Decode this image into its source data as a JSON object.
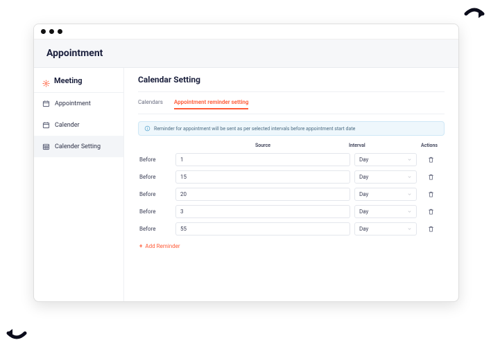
{
  "app_header": {
    "title": "Appointment"
  },
  "sidebar": {
    "top": {
      "label": "Meeting"
    },
    "items": [
      {
        "label": "Appointment"
      },
      {
        "label": "Calender"
      },
      {
        "label": "Calender Setting"
      }
    ]
  },
  "main": {
    "title": "Calendar Setting",
    "tabs": [
      {
        "label": "Calendars"
      },
      {
        "label": "Appointment reminder setting"
      }
    ],
    "info": "Reminder for appointment will be sent as per selected intervals before appointment start date",
    "columns": {
      "source": "Source",
      "interval": "Interval",
      "actions": "Actions"
    },
    "row_label": "Before",
    "interval_options": [
      "Day"
    ],
    "rows": [
      {
        "value": "1",
        "interval": "Day"
      },
      {
        "value": "15",
        "interval": "Day"
      },
      {
        "value": "20",
        "interval": "Day"
      },
      {
        "value": "3",
        "interval": "Day"
      },
      {
        "value": "55",
        "interval": "Day"
      }
    ],
    "add_label": "Add Reminder"
  },
  "colors": {
    "accent": "#ff5a36",
    "info_bg": "#eef7fc",
    "text_dark": "#1a1f3c"
  }
}
